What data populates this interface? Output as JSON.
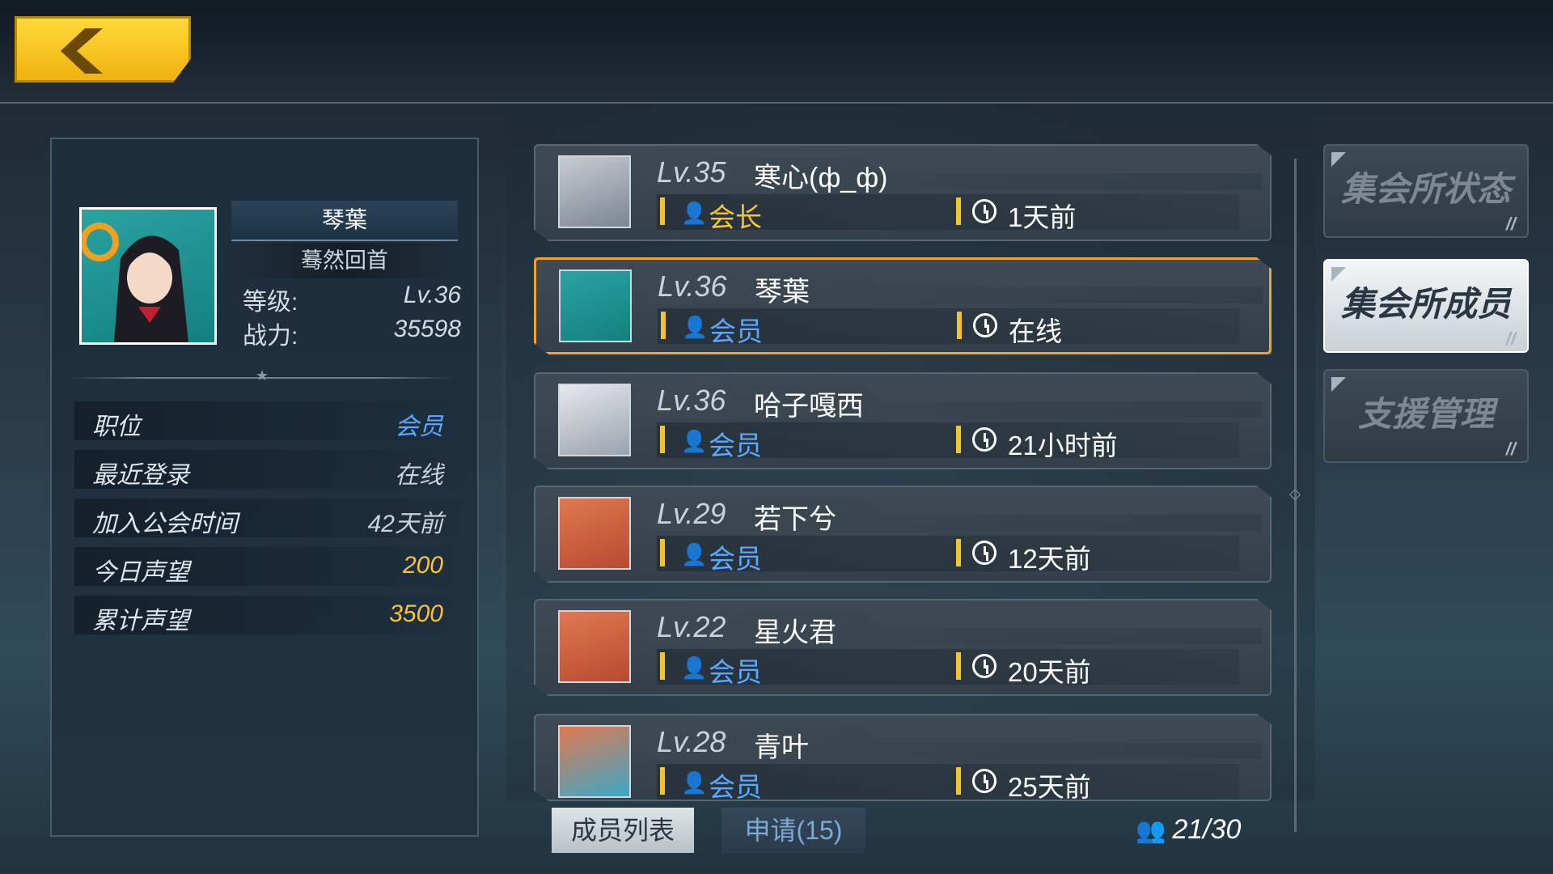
{
  "profile": {
    "name": "琴葉",
    "title": "蓦然回首",
    "level_label": "等级:",
    "level_value": "Lv.36",
    "power_label": "战力:",
    "power_value": "35598",
    "rows": [
      {
        "key": "职位",
        "value": "会员",
        "color": "#5aa8ff"
      },
      {
        "key": "最近登录",
        "value": "在线",
        "color": "#c9d2d9"
      },
      {
        "key": "加入公会时间",
        "value": "42天前",
        "color": "#c9d2d9"
      },
      {
        "key": "今日声望",
        "value": "200",
        "color": "#f7c533"
      },
      {
        "key": "累计声望",
        "value": "3500",
        "color": "#f7c533"
      }
    ]
  },
  "members": [
    {
      "level": "Lv.35",
      "name": "寒心(ф_ф)",
      "role": "会长",
      "role_color": "#f7c533",
      "time": "1天前"
    },
    {
      "level": "Lv.36",
      "name": "琴葉",
      "role": "会员",
      "role_color": "#5aa8ff",
      "time": "在线"
    },
    {
      "level": "Lv.36",
      "name": "哈子嘎西",
      "role": "会员",
      "role_color": "#5aa8ff",
      "time": "21小时前"
    },
    {
      "level": "Lv.29",
      "name": "若下兮",
      "role": "会员",
      "role_color": "#5aa8ff",
      "time": "12天前"
    },
    {
      "level": "Lv.22",
      "name": "星火君",
      "role": "会员",
      "role_color": "#5aa8ff",
      "time": "20天前"
    },
    {
      "level": "Lv.28",
      "name": "青叶",
      "role": "会员",
      "role_color": "#5aa8ff",
      "time": "25天前"
    }
  ],
  "side_tabs": [
    "集会所状态",
    "集会所成员",
    "支援管理"
  ],
  "bottom_tabs": {
    "members": "成员列表",
    "apply": "申请(15)"
  },
  "member_count": "21/30"
}
